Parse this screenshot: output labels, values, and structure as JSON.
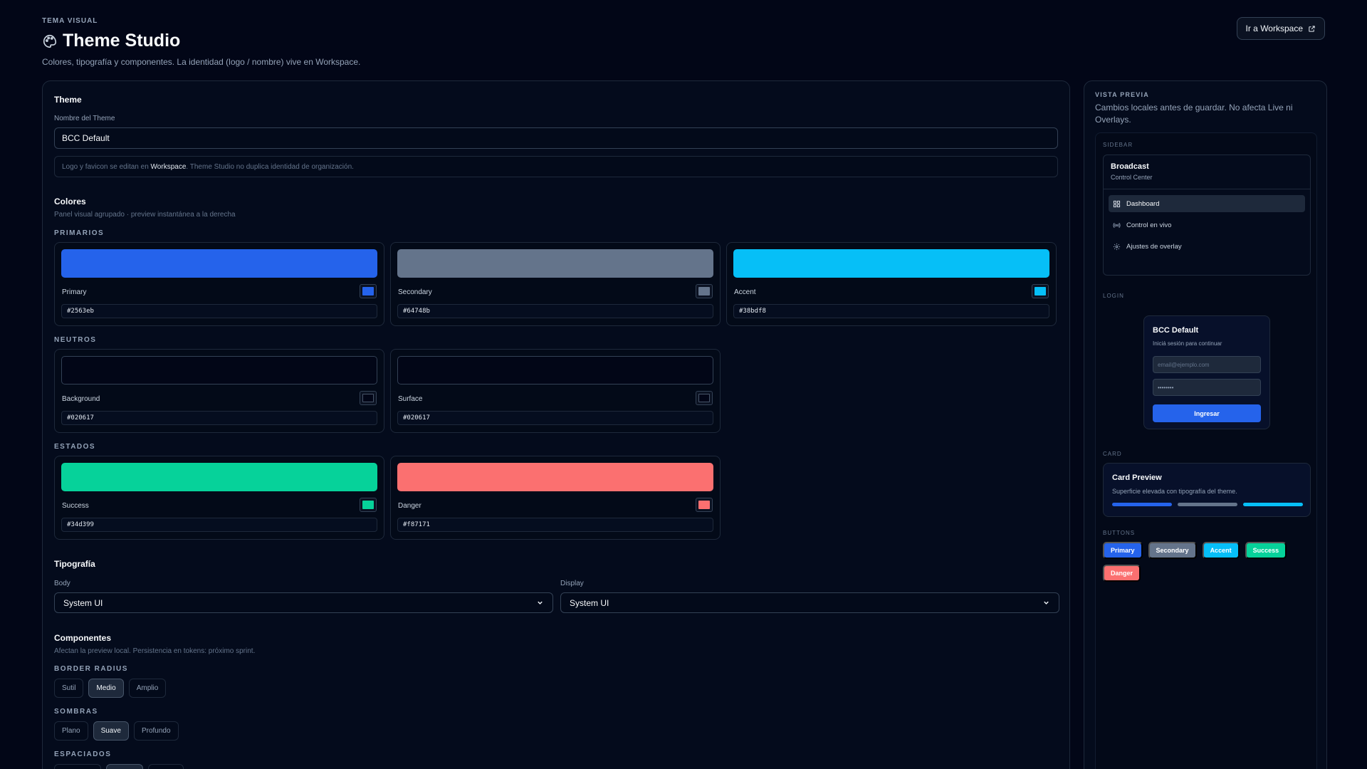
{
  "header": {
    "eyebrow": "TEMA VISUAL",
    "title": "Theme Studio",
    "subtitle": "Colores, tipografía y componentes. La identidad (logo / nombre) vive en Workspace.",
    "workspace_button": "Ir a Workspace"
  },
  "theme": {
    "section_title": "Theme",
    "name_label": "Nombre del Theme",
    "name_value": "BCC Default",
    "note_prefix": "Logo y favicon se editan en ",
    "note_link": "Workspace",
    "note_suffix": ". Theme Studio no duplica identidad de organización."
  },
  "colors": {
    "section_title": "Colores",
    "subtitle": "Panel visual agrupado · preview instantánea a la derecha",
    "groups": {
      "primarios": "PRIMARIOS",
      "neutros": "NEUTROS",
      "estados": "ESTADOS"
    },
    "primary": {
      "name": "Primary",
      "hex": "#2563eb"
    },
    "secondary": {
      "name": "Secondary",
      "hex": "#64748b"
    },
    "accent": {
      "name": "Accent",
      "hex": "#38bdf8"
    },
    "background": {
      "name": "Background",
      "hex": "#020617"
    },
    "surface": {
      "name": "Surface",
      "hex": "#020617"
    },
    "success": {
      "name": "Success",
      "hex": "#34d399"
    },
    "danger": {
      "name": "Danger",
      "hex": "#f87171"
    }
  },
  "typography": {
    "section_title": "Tipografía",
    "body_label": "Body",
    "body_value": "System UI",
    "display_label": "Display",
    "display_value": "System UI"
  },
  "components": {
    "section_title": "Componentes",
    "subtitle": "Afectan la preview local. Persistencia en tokens: próximo sprint.",
    "border_radius": {
      "label": "BORDER RADIUS",
      "options": [
        "Sutil",
        "Medio",
        "Amplio"
      ],
      "selected": "Medio"
    },
    "sombras": {
      "label": "SOMBRAS",
      "options": [
        "Plano",
        "Suave",
        "Profundo"
      ],
      "selected": "Suave"
    },
    "espaciados": {
      "label": "ESPACIADOS"
    }
  },
  "preview": {
    "eyebrow": "VISTA PREVIA",
    "description": "Cambios locales antes de guardar. No afecta Live ni Overlays.",
    "sidebar_label": "SIDEBAR",
    "sidebar": {
      "title": "Broadcast",
      "subtitle": "Control Center",
      "items": [
        {
          "label": "Dashboard",
          "icon": "grid-icon",
          "active": true
        },
        {
          "label": "Control en vivo",
          "icon": "broadcast-icon",
          "active": false
        },
        {
          "label": "Ajustes de overlay",
          "icon": "gear-icon",
          "active": false
        }
      ]
    },
    "login_label": "LOGIN",
    "login": {
      "title": "BCC Default",
      "subtitle": "Iniciá sesión para continuar",
      "email_placeholder": "email@ejemplo.com",
      "password_value": "••••••••",
      "button": "Ingresar"
    },
    "card_label": "CARD",
    "card": {
      "title": "Card Preview",
      "subtitle": "Superficie elevada con tipografía del theme."
    },
    "buttons_label": "BUTTONS",
    "buttons": [
      "Primary",
      "Secondary",
      "Accent",
      "Success",
      "Danger"
    ]
  }
}
